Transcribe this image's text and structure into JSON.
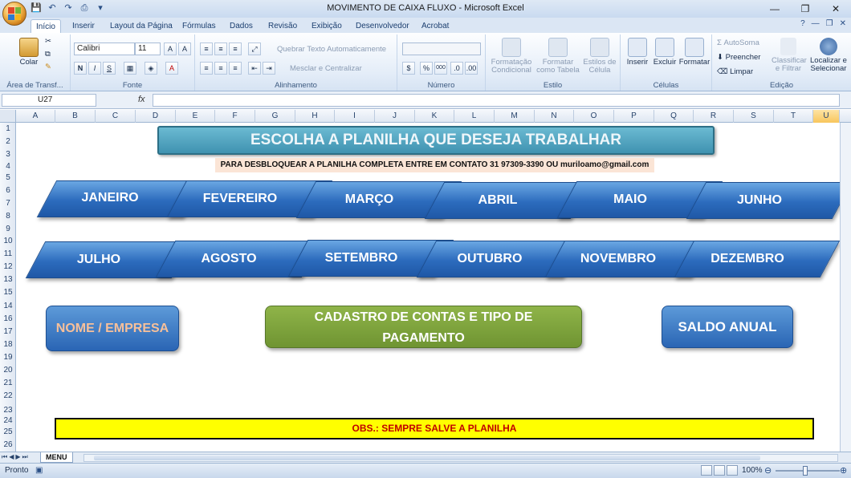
{
  "window": {
    "title": "MOVIMENTO DE CAIXA FLUXO - Microsoft Excel"
  },
  "ribbon_tabs": [
    "Início",
    "Inserir",
    "Layout da Página",
    "Fórmulas",
    "Dados",
    "Revisão",
    "Exibição",
    "Desenvolvedor",
    "Acrobat"
  ],
  "ribbon": {
    "clipboard": {
      "paste": "Colar",
      "label": "Área de Transf..."
    },
    "font": {
      "family": "Calibri",
      "size": "11",
      "label": "Fonte"
    },
    "alignment": {
      "wrap": "Quebrar Texto Automaticamente",
      "merge": "Mesclar e Centralizar",
      "label": "Alinhamento"
    },
    "number": {
      "label": "Número",
      "percent": "%",
      "comma": "000"
    },
    "styles": {
      "cond_format_1": "Formatação",
      "cond_format_2": "Condicional",
      "table_1": "Formatar",
      "table_2": "como Tabela",
      "cell_1": "Estilos de",
      "cell_2": "Célula",
      "label": "Estilo"
    },
    "cells": {
      "insert": "Inserir",
      "delete": "Excluir",
      "format": "Formatar",
      "label": "Células"
    },
    "editing": {
      "autosum": "AutoSoma",
      "fill": "Preencher",
      "clear": "Limpar",
      "sort_1": "Classificar",
      "sort_2": "e Filtrar",
      "find_1": "Localizar e",
      "find_2": "Selecionar",
      "label": "Edição"
    }
  },
  "formula_bar": {
    "name_box": "U27",
    "fx": "fx"
  },
  "columns": [
    "A",
    "B",
    "C",
    "D",
    "E",
    "F",
    "G",
    "H",
    "I",
    "J",
    "K",
    "L",
    "M",
    "N",
    "O",
    "P",
    "Q",
    "R",
    "S",
    "T",
    "U"
  ],
  "rows": [
    "1",
    "2",
    "3",
    "4",
    "5",
    "6",
    "7",
    "8",
    "9",
    "10",
    "11",
    "12",
    "13",
    "14",
    "15",
    "16",
    "17",
    "18",
    "19",
    "20",
    "21",
    "22",
    "23",
    "24",
    "25",
    "26"
  ],
  "sheet": {
    "banner": "ESCOLHA A PLANILHA QUE DESEJA TRABALHAR",
    "contact": "PARA DESBLOQUEAR A PLANILHA COMPLETA ENTRE EM CONTATO 31 97309-3390 OU muriloamo@gmail.com",
    "months_row1": [
      "JANEIRO",
      "FEVEREIRO",
      "MARÇO",
      "ABRIL",
      "MAIO",
      "JUNHO"
    ],
    "months_row2": [
      "JULHO",
      "AGOSTO",
      "SETEMBRO",
      "OUTUBRO",
      "NOVEMBRO",
      "DEZEMBRO"
    ],
    "btn_nome": "NOME / EMPRESA",
    "btn_cadastro_1": "CADASTRO DE CONTAS E TIPO DE",
    "btn_cadastro_2": "PAGAMENTO",
    "btn_saldo": "SALDO ANUAL",
    "obs": "OBS.: SEMPRE SALVE A PLANILHA"
  },
  "sheet_tab": "MENU",
  "status": {
    "ready": "Pronto",
    "zoom": "100%"
  }
}
